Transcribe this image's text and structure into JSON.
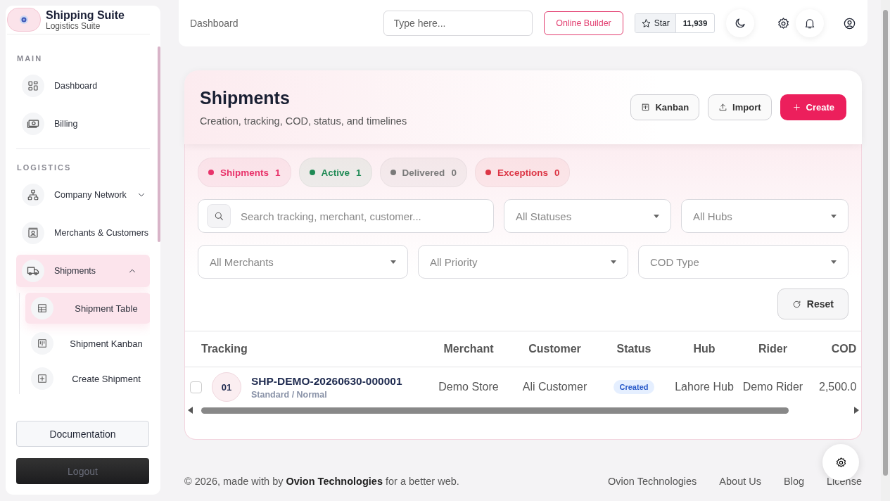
{
  "brand": {
    "title": "Shipping Suite",
    "subtitle": "Logistics Suite"
  },
  "sidebar": {
    "sections": [
      {
        "heading": "MAIN",
        "items": [
          {
            "label": "Dashboard",
            "selected": false
          },
          {
            "label": "Billing",
            "selected": false
          }
        ]
      },
      {
        "heading": "LOGISTICS",
        "items": [
          {
            "label": "Company Network",
            "selected": false,
            "expanded": false
          },
          {
            "label": "Merchants & Customers",
            "selected": false
          },
          {
            "label": "Shipments",
            "selected": true,
            "expanded": true,
            "children": [
              {
                "label": "Shipment Table",
                "selected": true
              },
              {
                "label": "Shipment Kanban",
                "selected": false
              },
              {
                "label": "Create Shipment",
                "selected": false
              }
            ]
          }
        ]
      }
    ],
    "buttons": [
      {
        "label": "Documentation",
        "kind": "light"
      },
      {
        "label": "Logout",
        "kind": "dark"
      }
    ]
  },
  "topbar": {
    "breadcrumb": "Dashboard",
    "search": {
      "placeholder": "Type here..."
    },
    "builder_button": "Online Builder",
    "star": {
      "label": "Star",
      "count": "11,939"
    }
  },
  "header": {
    "title": "Shipments",
    "subtitle": "Creation, tracking, COD, status, and timelines",
    "actions": [
      {
        "label": "Kanban",
        "kind": "outline"
      },
      {
        "label": "Import",
        "kind": "outline"
      },
      {
        "label": "Create",
        "kind": "primary"
      }
    ]
  },
  "stats": [
    {
      "label": "Shipments",
      "count": "1",
      "color": "#e8336b"
    },
    {
      "label": "Active",
      "count": "1",
      "color": "#1f8a55"
    },
    {
      "label": "Delivered",
      "count": "0",
      "color": "#7a7a7a"
    },
    {
      "label": "Exceptions",
      "count": "0",
      "color": "#dc3545"
    }
  ],
  "filters": {
    "search": {
      "placeholder": "Search tracking, merchant, customer..."
    },
    "selects": [
      "All Statuses",
      "All Hubs",
      "All Merchants",
      "All Priority",
      "COD Type"
    ],
    "reset": "Reset"
  },
  "table": {
    "columns": [
      "Tracking",
      "Merchant",
      "Customer",
      "Status",
      "Hub",
      "Rider",
      "COD"
    ],
    "rows": [
      {
        "checked": false,
        "index": "01",
        "tracking": "SHP-DEMO-20260630-000001",
        "service": "Standard / Normal",
        "merchant": "Demo Store",
        "customer": "Ali Customer",
        "status": "Created",
        "hub": "Lahore Hub",
        "rider": "Demo Rider",
        "cod": "2,500.0"
      }
    ]
  },
  "footer": {
    "copyright": "© 2026, made with by **Ovion Technologies** for a better web.",
    "links": [
      "Ovion Technologies",
      "About Us",
      "Blog",
      "License"
    ]
  }
}
